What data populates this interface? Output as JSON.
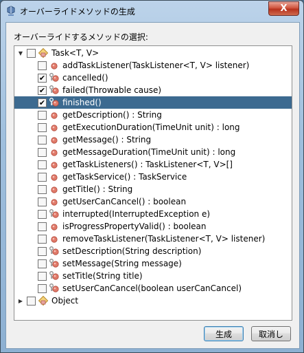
{
  "window": {
    "title": "オーバーライドメソッドの生成",
    "close_label": "X"
  },
  "dialog": {
    "prompt": "オーバーライドするメソッドの選択:",
    "ok_label": "生成",
    "cancel_label": "取消し"
  },
  "tree": {
    "nodes": [
      {
        "label": "Task<T, V>",
        "kind": "class",
        "expanded": true,
        "checked": false
      },
      {
        "label": "addTaskListener(TaskListener<T, V> listener)",
        "kind": "method",
        "checked": false
      },
      {
        "label": "cancelled()",
        "kind": "key-method",
        "checked": true
      },
      {
        "label": "failed(Throwable cause)",
        "kind": "key-method",
        "checked": true
      },
      {
        "label": "finished()",
        "kind": "key-method",
        "checked": true,
        "selected": true
      },
      {
        "label": "getDescription() : String",
        "kind": "method",
        "checked": false
      },
      {
        "label": "getExecutionDuration(TimeUnit unit) : long",
        "kind": "method",
        "checked": false
      },
      {
        "label": "getMessage() : String",
        "kind": "method",
        "checked": false
      },
      {
        "label": "getMessageDuration(TimeUnit unit) : long",
        "kind": "method",
        "checked": false
      },
      {
        "label": "getTaskListeners() : TaskListener<T, V>[]",
        "kind": "method",
        "checked": false
      },
      {
        "label": "getTaskService() : TaskService",
        "kind": "method",
        "checked": false
      },
      {
        "label": "getTitle() : String",
        "kind": "method",
        "checked": false
      },
      {
        "label": "getUserCanCancel() : boolean",
        "kind": "method",
        "checked": false
      },
      {
        "label": "interrupted(InterruptedException e)",
        "kind": "key-method",
        "checked": false
      },
      {
        "label": "isProgressPropertyValid() : boolean",
        "kind": "method",
        "checked": false
      },
      {
        "label": "removeTaskListener(TaskListener<T, V> listener)",
        "kind": "method",
        "checked": false
      },
      {
        "label": "setDescription(String description)",
        "kind": "key-method",
        "checked": false
      },
      {
        "label": "setMessage(String message)",
        "kind": "key-method",
        "checked": false
      },
      {
        "label": "setTitle(String title)",
        "kind": "key-method",
        "checked": false
      },
      {
        "label": "setUserCanCancel(boolean userCanCancel)",
        "kind": "key-method",
        "checked": false
      },
      {
        "label": "Object",
        "kind": "class",
        "expanded": false,
        "checked": false
      }
    ]
  },
  "colors": {
    "selection": "#3c6a90",
    "method_dot": "#e07a6a",
    "key_icon": "#8a8a8a"
  },
  "icons": {
    "window": "java-cup-icon",
    "class": "class-icon",
    "method": "method-icon",
    "key_method": "protected-method-icon"
  }
}
